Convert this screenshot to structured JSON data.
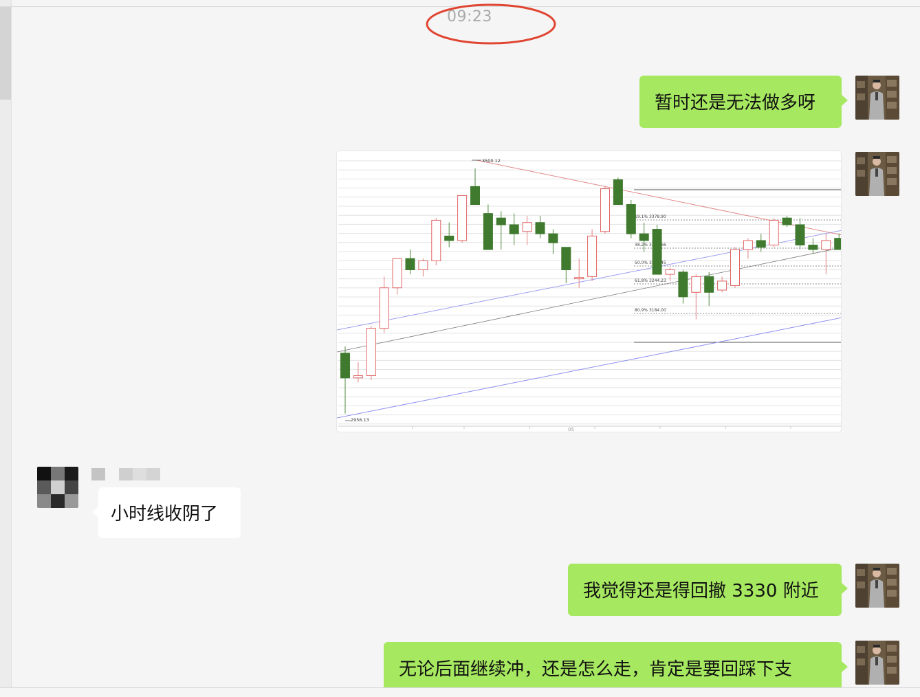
{
  "conversation": {
    "timestamp": "09:23",
    "messages": [
      {
        "id": "m1",
        "side": "right",
        "text": "暂时还是无法做多呀"
      },
      {
        "id": "m2",
        "side": "right",
        "type": "chart-image"
      },
      {
        "id": "m3",
        "side": "left",
        "text": "小时线收阴了"
      },
      {
        "id": "m4",
        "side": "right",
        "text": "我觉得还是得回撤 3330 附近"
      },
      {
        "id": "m5",
        "side": "right",
        "text": "无论后面继续冲，还是怎么走，肯定是要回踩下支"
      }
    ]
  },
  "chart_labels": {
    "high": "3500.12",
    "low": "2956.13",
    "fib_191": "19.1% 3378.90",
    "fib_382": "38.2% 3318.66",
    "fib_500": "50.0% 3281.45",
    "fib_618": "61.8% 3244.23",
    "fib_809": "80.9% 3184.00",
    "xtick": "05"
  },
  "chart_data": {
    "type": "candlestick",
    "title": "",
    "high_label": 3500.12,
    "low_label": 2956.13,
    "fib_levels": [
      {
        "label": "19.1%",
        "value": 3378.9
      },
      {
        "label": "38.2%",
        "value": 3318.66
      },
      {
        "label": "50.0%",
        "value": 3281.45
      },
      {
        "label": "61.8%",
        "value": 3244.23
      },
      {
        "label": "80.9%",
        "value": 3184.0
      }
    ],
    "ylim": [
      2940,
      3520
    ],
    "candles": [
      {
        "o": 3090,
        "h": 3105,
        "l": 2956,
        "c": 3035
      },
      {
        "o": 3035,
        "h": 3070,
        "l": 3025,
        "c": 3040
      },
      {
        "o": 3040,
        "h": 3150,
        "l": 3030,
        "c": 3145
      },
      {
        "o": 3145,
        "h": 3260,
        "l": 3135,
        "c": 3235
      },
      {
        "o": 3235,
        "h": 3285,
        "l": 3220,
        "c": 3300
      },
      {
        "o": 3300,
        "h": 3320,
        "l": 3265,
        "c": 3275
      },
      {
        "o": 3275,
        "h": 3300,
        "l": 3260,
        "c": 3295
      },
      {
        "o": 3295,
        "h": 3390,
        "l": 3285,
        "c": 3385
      },
      {
        "o": 3350,
        "h": 3380,
        "l": 3325,
        "c": 3340
      },
      {
        "o": 3340,
        "h": 3440,
        "l": 3335,
        "c": 3440
      },
      {
        "o": 3460,
        "h": 3500,
        "l": 3430,
        "c": 3420
      },
      {
        "o": 3400,
        "h": 3420,
        "l": 3320,
        "c": 3320
      },
      {
        "o": 3390,
        "h": 3405,
        "l": 3320,
        "c": 3375
      },
      {
        "o": 3375,
        "h": 3400,
        "l": 3330,
        "c": 3355
      },
      {
        "o": 3360,
        "h": 3395,
        "l": 3330,
        "c": 3380
      },
      {
        "o": 3380,
        "h": 3395,
        "l": 3345,
        "c": 3355
      },
      {
        "o": 3355,
        "h": 3365,
        "l": 3310,
        "c": 3335
      },
      {
        "o": 3325,
        "h": 3325,
        "l": 3245,
        "c": 3275
      },
      {
        "o": 3255,
        "h": 3300,
        "l": 3235,
        "c": 3258
      },
      {
        "o": 3260,
        "h": 3365,
        "l": 3250,
        "c": 3350
      },
      {
        "o": 3360,
        "h": 3460,
        "l": 3355,
        "c": 3455
      },
      {
        "o": 3475,
        "h": 3480,
        "l": 3420,
        "c": 3420
      },
      {
        "o": 3420,
        "h": 3430,
        "l": 3345,
        "c": 3355
      },
      {
        "o": 3355,
        "h": 3380,
        "l": 3315,
        "c": 3340
      },
      {
        "o": 3365,
        "h": 3375,
        "l": 3270,
        "c": 3265
      },
      {
        "o": 3265,
        "h": 3280,
        "l": 3250,
        "c": 3275
      },
      {
        "o": 3270,
        "h": 3275,
        "l": 3200,
        "c": 3215
      },
      {
        "o": 3225,
        "h": 3265,
        "l": 3165,
        "c": 3260
      },
      {
        "o": 3260,
        "h": 3270,
        "l": 3195,
        "c": 3225
      },
      {
        "o": 3230,
        "h": 3260,
        "l": 3225,
        "c": 3250
      },
      {
        "o": 3240,
        "h": 3325,
        "l": 3235,
        "c": 3320
      },
      {
        "o": 3320,
        "h": 3345,
        "l": 3300,
        "c": 3340
      },
      {
        "o": 3340,
        "h": 3355,
        "l": 3315,
        "c": 3325
      },
      {
        "o": 3330,
        "h": 3390,
        "l": 3325,
        "c": 3385
      },
      {
        "o": 3390,
        "h": 3395,
        "l": 3370,
        "c": 3375
      },
      {
        "o": 3375,
        "h": 3390,
        "l": 3320,
        "c": 3330
      },
      {
        "o": 3330,
        "h": 3345,
        "l": 3310,
        "c": 3320
      },
      {
        "o": 3320,
        "h": 3355,
        "l": 3265,
        "c": 3340
      },
      {
        "o": 3345,
        "h": 3355,
        "l": 3320,
        "c": 3320
      }
    ]
  }
}
